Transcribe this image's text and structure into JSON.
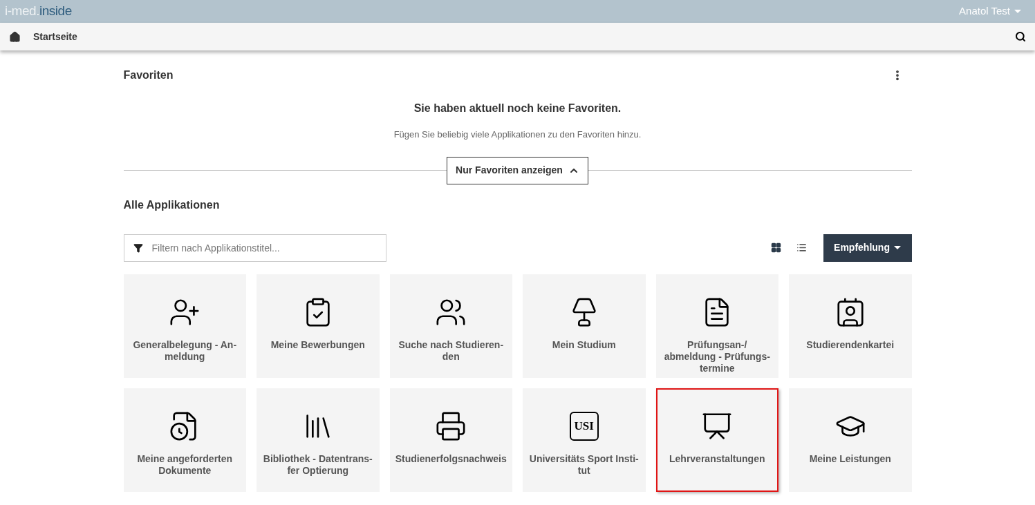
{
  "top_bar": {
    "logo": {
      "light": "i-med.",
      "dark": "inside"
    },
    "user": "Anatol Test"
  },
  "nav": {
    "title": "Startseite"
  },
  "favorites": {
    "title": "Favoriten",
    "empty_title": "Sie haben aktuell noch keine Favoriten.",
    "empty_text": "Fügen Sie beliebig viele Applikationen zu den Favoriten hinzu.",
    "toggle": "Nur Favoriten anzeigen"
  },
  "apps": {
    "title": "Alle Applikationen",
    "filter": {
      "placeholder": "Filtern nach Applikationstitel..."
    },
    "views": [
      {
        "kind": "grid",
        "selected": true
      },
      {
        "kind": "list",
        "selected": false
      }
    ],
    "sort": "Empfehlung",
    "tiles": [
      {
        "lines": [
          "Generalbelegung - An-",
          "meldung"
        ],
        "selected": false
      },
      {
        "lines": [
          "Meine Bewerbungen"
        ],
        "selected": false
      },
      {
        "lines": [
          "Suche nach Studieren-",
          "den"
        ],
        "selected": false
      },
      {
        "lines": [
          "Mein Studium"
        ],
        "selected": false
      },
      {
        "lines": [
          "Prüfungsan-/",
          "abmeldung - Prüfungs-",
          "termine"
        ],
        "selected": false
      },
      {
        "lines": [
          "Studierendenkartei"
        ],
        "selected": false
      },
      {
        "lines": [
          "Meine angeforderten",
          "Dokumente"
        ],
        "selected": false
      },
      {
        "lines": [
          "Bibliothek - Datentrans-",
          "fer Optierung"
        ],
        "selected": false
      },
      {
        "lines": [
          "Studienerfolgsnachweis"
        ],
        "selected": false
      },
      {
        "icon_text": "USI",
        "lines": [
          "Universitäts Sport Insti-",
          "tut"
        ],
        "selected": false
      },
      {
        "lines": [
          "Lehrveranstaltungen"
        ],
        "selected": true
      },
      {
        "lines": [
          "Meine Leistungen"
        ],
        "selected": false
      }
    ]
  }
}
